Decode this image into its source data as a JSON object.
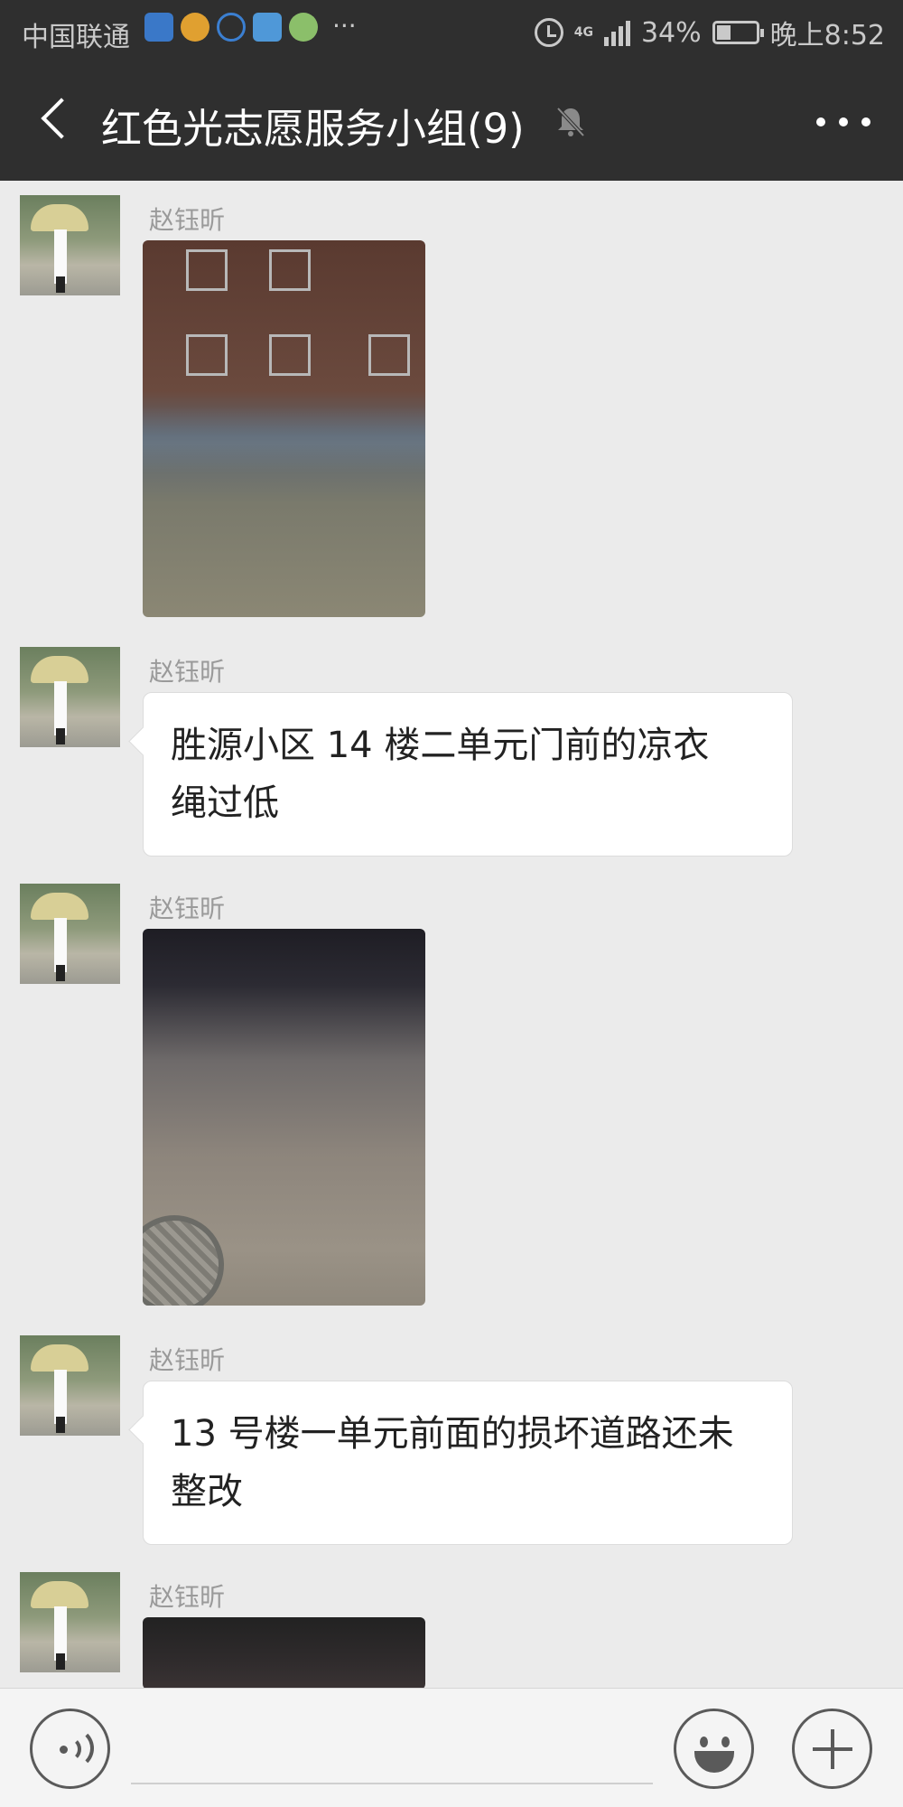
{
  "status_bar": {
    "carrier": "中国联通",
    "notification_icons": [
      "shield-icon",
      "mail-icon",
      "headset-icon",
      "card-icon",
      "app-icon"
    ],
    "more": "···",
    "network": "4G",
    "battery": "34%",
    "time": "晚上8:52"
  },
  "header": {
    "title": "红色光志愿服务小组(9)",
    "muted": true
  },
  "messages": [
    {
      "sender": "赵钰昕",
      "type": "image",
      "description": "night photo of building"
    },
    {
      "sender": "赵钰昕",
      "type": "text",
      "lines": [
        "胜源小区 14 楼二单元门前的凉衣",
        "绳过低"
      ]
    },
    {
      "sender": "赵钰昕",
      "type": "image",
      "description": "night photo of road"
    },
    {
      "sender": "赵钰昕",
      "type": "text",
      "lines": [
        "13 号楼一单元前面的损坏道路还未",
        "整改"
      ]
    },
    {
      "sender": "赵钰昕",
      "type": "image",
      "description": "night photo partial"
    }
  ],
  "input_bar": {
    "text_value": ""
  },
  "colors": {
    "header_bg": "#2f2f2f",
    "chat_bg": "#ebebeb",
    "bubble_bg": "#ffffff"
  }
}
